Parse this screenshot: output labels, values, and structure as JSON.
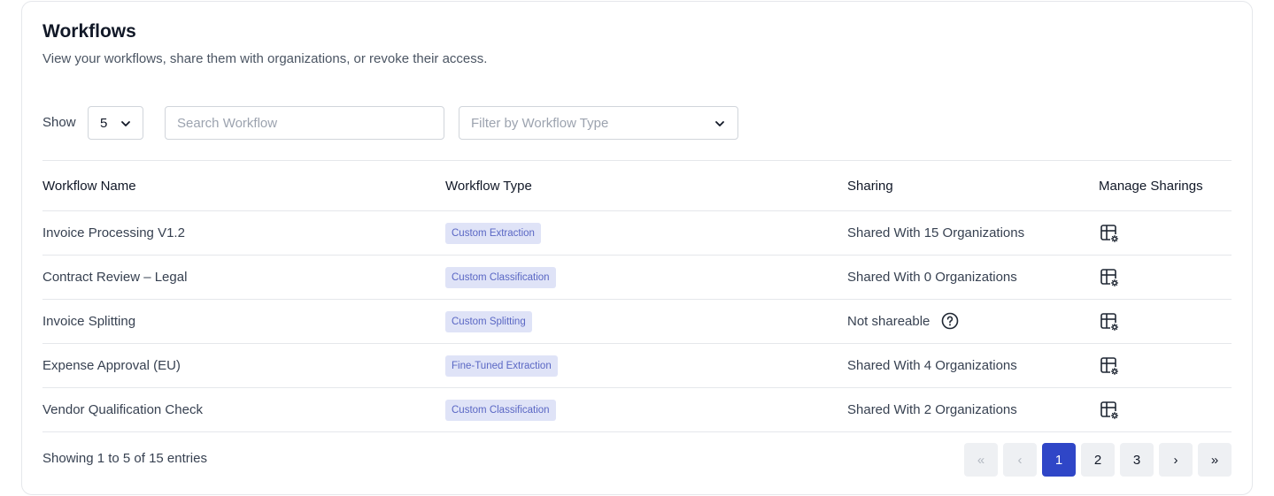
{
  "header": {
    "title": "Workflows",
    "subtitle": "View your workflows, share them with organizations, or revoke their access."
  },
  "controls": {
    "show_label": "Show",
    "page_size": "5",
    "search_placeholder": "Search Workflow",
    "filter_placeholder": "Filter by Workflow Type"
  },
  "table": {
    "columns": [
      "Workflow Name",
      "Workflow Type",
      "Sharing",
      "Manage Sharings"
    ],
    "rows": [
      {
        "name": "Invoice Processing V1.2",
        "type": "Custom Extraction",
        "sharing": "Shared With 15 Organizations",
        "shareable": true
      },
      {
        "name": "Contract Review – Legal",
        "type": "Custom Classification",
        "sharing": "Shared With 0 Organizations",
        "shareable": true
      },
      {
        "name": "Invoice Splitting",
        "type": "Custom Splitting",
        "sharing": "Not shareable",
        "shareable": false
      },
      {
        "name": "Expense Approval (EU)",
        "type": "Fine-Tuned Extraction",
        "sharing": "Shared With 4 Organizations",
        "shareable": true
      },
      {
        "name": "Vendor Qualification Check",
        "type": "Custom Classification",
        "sharing": "Shared With 2 Organizations",
        "shareable": true
      }
    ]
  },
  "footer": {
    "entries_text": "Showing 1 to 5 of 15 entries"
  },
  "pagination": {
    "first": "«",
    "prev": "‹",
    "pages": [
      "1",
      "2",
      "3"
    ],
    "current_page": "1",
    "next": "›",
    "last": "»"
  },
  "colors": {
    "accent": "#2f46c7",
    "badge_bg": "#dfe3f7",
    "badge_text": "#5a67c4"
  },
  "icons": {
    "manage": "table-settings-icon",
    "help": "question-circle-icon",
    "chevron": "chevron-down-icon"
  }
}
